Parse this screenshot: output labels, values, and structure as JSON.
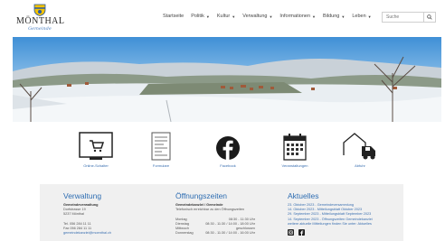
{
  "header": {
    "logo_name": "MÖNTHAL",
    "logo_sub": "Gemeinde",
    "nav": [
      {
        "label": "Startseite",
        "dropdown": false
      },
      {
        "label": "Politik",
        "dropdown": true
      },
      {
        "label": "Kultur",
        "dropdown": true
      },
      {
        "label": "Verwaltung",
        "dropdown": true
      },
      {
        "label": "Informationen",
        "dropdown": true
      },
      {
        "label": "Bildung",
        "dropdown": true
      },
      {
        "label": "Leben",
        "dropdown": true
      }
    ],
    "search_placeholder": "Suche"
  },
  "quicklinks": [
    {
      "label": "Online-Schalter",
      "icon": "cart-icon"
    },
    {
      "label": "Formulare",
      "icon": "form-icon"
    },
    {
      "label": "Facebook",
      "icon": "facebook-icon"
    },
    {
      "label": "Veranstaltungen",
      "icon": "calendar-icon"
    },
    {
      "label": "Abfuhr",
      "icon": "garbage-truck-icon"
    }
  ],
  "footer": {
    "verwaltung": {
      "title": "Verwaltung",
      "lines": [
        "Gemeindeverwaltung",
        "Dorfstrasse 19",
        "5237 Mönthal",
        "",
        "Tel. 056 284 11 11",
        "Fax 056 284 11 11",
        "gemeindekanzlei@moenthal.ch"
      ]
    },
    "oeffnungszeiten": {
      "title": "Öffnungszeiten",
      "subtitle": "Gemeindekanzlei / Gemeinde",
      "note": "Telefonisch erreichbar zu den Öffnungszeiten",
      "rows": [
        {
          "day": "Montag",
          "time": "08:30 - 11:30 Uhr"
        },
        {
          "day": "Dienstag",
          "time": "08:30 - 11:30 / 14:00 - 18:00 Uhr"
        },
        {
          "day": "Mittwoch",
          "time": "geschlossen"
        },
        {
          "day": "Donnerstag",
          "time": "08:30 - 11:30 / 14:00 - 16:00 Uhr"
        }
      ]
    },
    "aktuelles": {
      "title": "Aktuelles",
      "lines": [
        "23. Oktober 2023 - Gemeindeversammlung",
        "14. Oktober 2023 - Mitteilungsblatt Oktober 2023",
        "29. September 2023 - Mitteilungsblatt September 2023",
        "14. September 2023 - Öffnungszeiten Gemeindekanzlei",
        "weitere aktuelle Mitteilungen finden Sie unter: Aktuelles"
      ]
    }
  }
}
